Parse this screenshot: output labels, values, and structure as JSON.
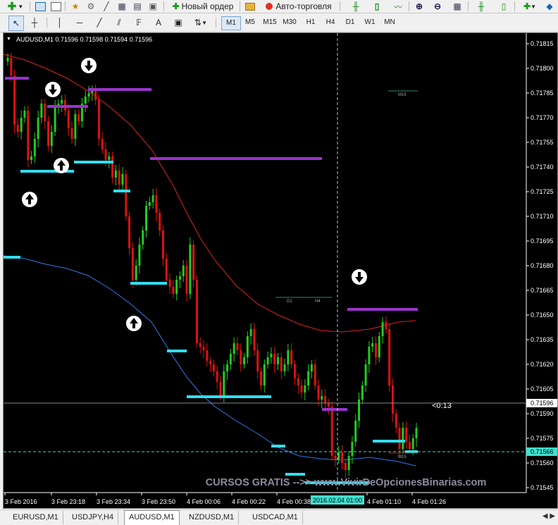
{
  "toolbar": {
    "new_order": "Новый ордер",
    "auto_trading": "Авто-торговля"
  },
  "timeframes": [
    "M1",
    "M5",
    "M15",
    "M30",
    "H1",
    "H4",
    "D1",
    "W1",
    "MN"
  ],
  "chart": {
    "symbol_info": "AUDUSD,M1  0.71596 0.71598 0.71594 0.71596",
    "price_labels": [
      "0.71815",
      "0.71800",
      "0.71785",
      "0.71770",
      "0.71755",
      "0.71740",
      "0.71725",
      "0.71710",
      "0.71695",
      "0.71680",
      "0.71665",
      "0.71650",
      "0.71635",
      "0.71620",
      "0.71605",
      "0.71590",
      "0.71575",
      "0.71560",
      "0.71545"
    ],
    "current_price": "0.71596",
    "line_price": "0.71566",
    "countdown": "<0:13",
    "time_labels": [
      "3 Feb 2016",
      "3 Feb 23:18",
      "3 Feb 23:34",
      "3 Feb 23:50",
      "4 Feb 00:06",
      "4 Feb 00:22",
      "4 Feb 00:38",
      "4 Feb 01:10",
      "4 Feb 01:26"
    ],
    "cursor_time": "2016.02.04 01:00",
    "watermark": "CURSOS GRATIS -->> www.VivirDeOpcionesBinarias.com",
    "level_labels": {
      "m15_top": "M15",
      "d1": "D1",
      "h4": "H4",
      "m15_bottom": "M15"
    },
    "colors": {
      "background": "#000000",
      "bull": "#22cc22",
      "bear": "#dd1111",
      "resistance": "#9933cc",
      "support": "#33ddee",
      "ma_red": "#dd2222",
      "ma_blue": "#3377ee"
    }
  },
  "tabs": [
    "EURUSD,M1",
    "USDJPY,H4",
    "AUDUSD,M1",
    "NZDUSD,M1",
    "USDCAD,M1"
  ],
  "active_tab": "AUDUSD,M1"
}
